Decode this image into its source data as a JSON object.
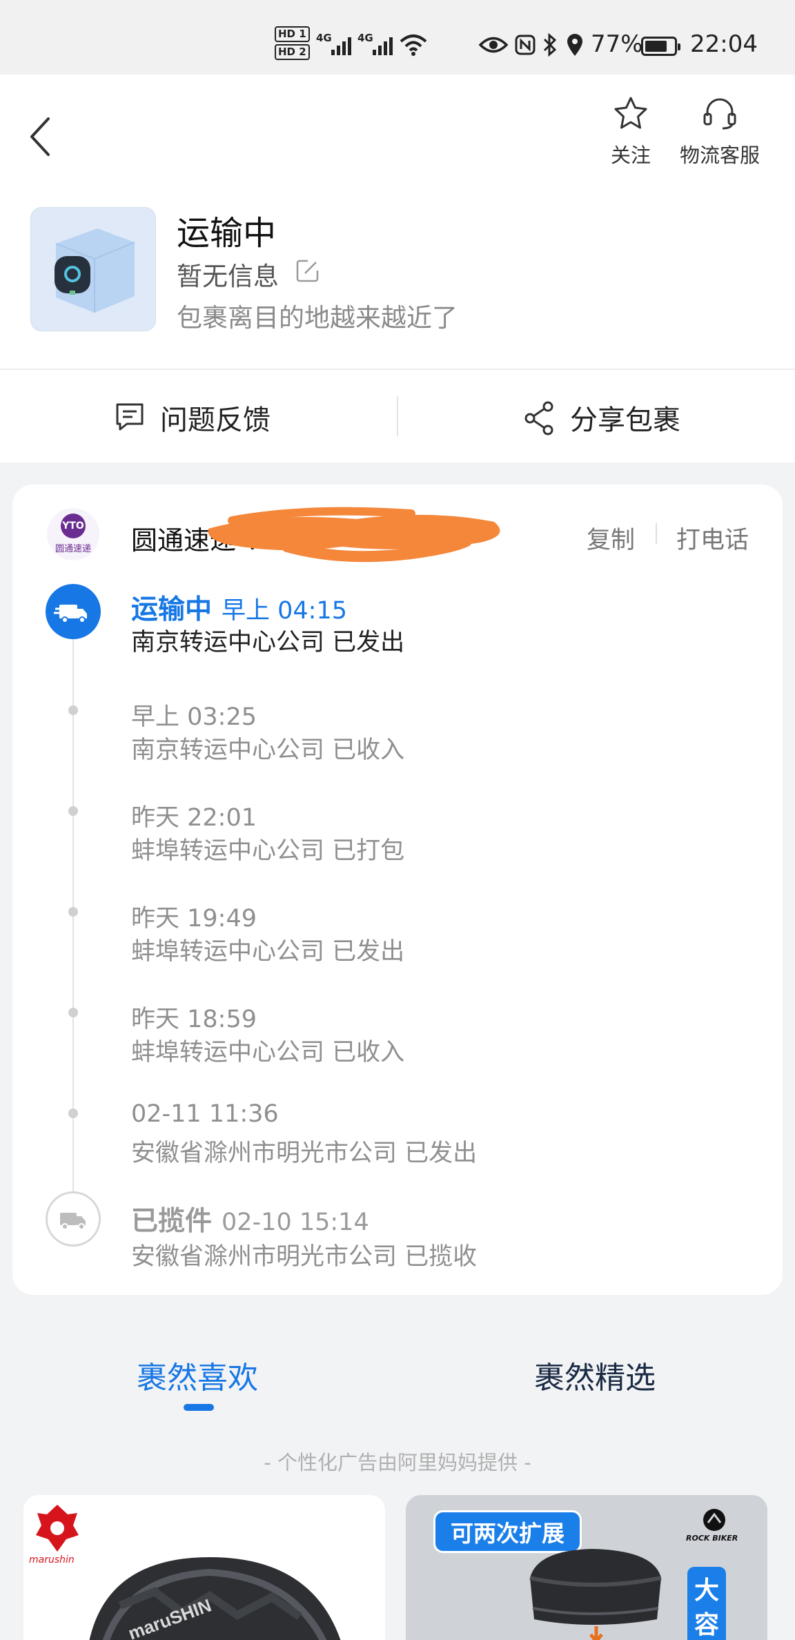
{
  "status_bar": {
    "hd1": "HD 1",
    "hd2": "HD 2",
    "sig1": "4G",
    "sig2": "4G",
    "battery": "77%",
    "battery_level": 0.77,
    "time": "22:04"
  },
  "header": {
    "follow_label": "关注",
    "service_label": "物流客服",
    "status_title": "运输中",
    "sub_info": "暂无信息",
    "hint": "包裹离目的地越来越近了"
  },
  "actions": {
    "feedback": "问题反馈",
    "share": "分享包裹"
  },
  "tracking": {
    "courier_logo_text": "圆通速递",
    "courier_logo_mark": "YTO",
    "courier_name": "圆通速递 YT",
    "copy": "复制",
    "call": "打电话",
    "events": [
      {
        "status": "运输中",
        "time": "早上 04:15",
        "desc": "南京转运中心公司 已发出"
      },
      {
        "status": "",
        "time": "早上 03:25",
        "desc": "南京转运中心公司 已收入"
      },
      {
        "status": "",
        "time": "昨天 22:01",
        "desc": "蚌埠转运中心公司 已打包"
      },
      {
        "status": "",
        "time": "昨天 19:49",
        "desc": "蚌埠转运中心公司 已发出"
      },
      {
        "status": "",
        "time": "昨天 18:59",
        "desc": "蚌埠转运中心公司 已收入"
      },
      {
        "status": "",
        "time": "02-11 11:36",
        "desc": "安徽省滁州市明光市公司 已发出"
      },
      {
        "status": "已揽件",
        "time": "02-10 15:14",
        "desc": "安徽省滁州市明光市公司 已揽收"
      }
    ]
  },
  "recommend": {
    "tab1": "裹然喜欢",
    "tab2": "裹然精选",
    "ad_note": "- 个性化广告由阿里妈妈提供 -",
    "left_brand": "marushin",
    "right_badge": "可两次扩展",
    "right_brand": "ROCK BIKER",
    "right_tag": "大容"
  },
  "colors": {
    "accent": "#1677e5",
    "courier": "#6a2c91",
    "redaction": "#f5873a"
  }
}
